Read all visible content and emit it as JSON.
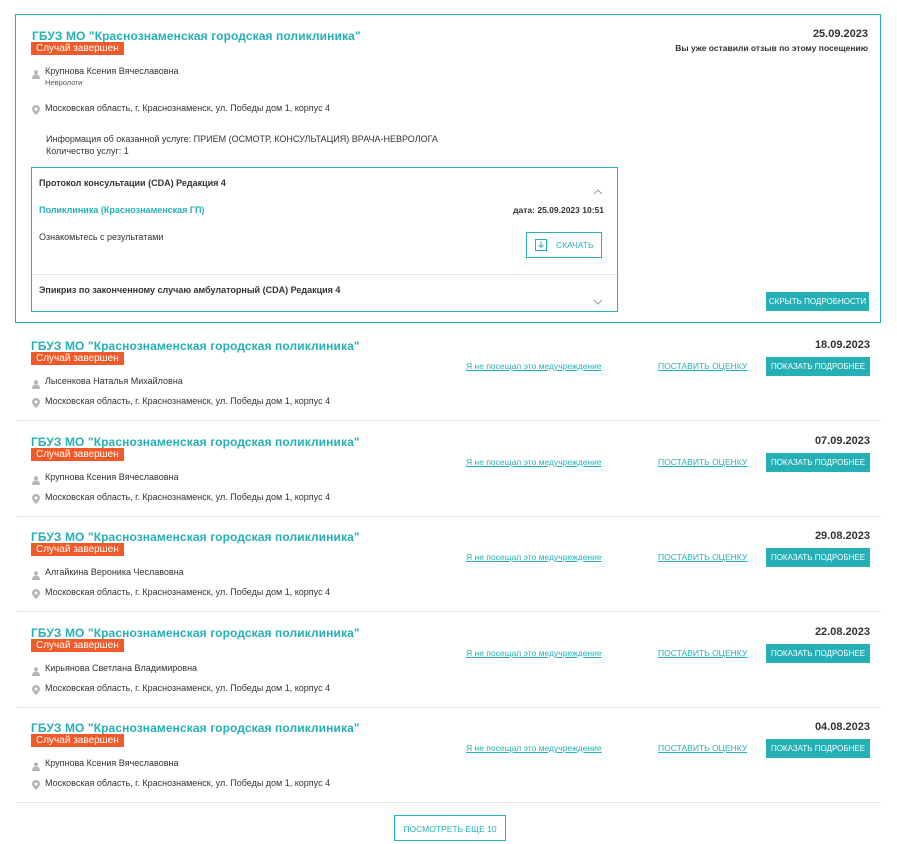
{
  "expanded": {
    "clinic": "ГБУЗ МО \"Краснознаменская городская поликлиника\"",
    "status": "Случай завершен",
    "doctor": "Крупнова Ксения Вячеславовна",
    "specialty": "Неврологи",
    "address": "Московская область, г. Краснознаменск, ул. Победы дом 1, корпус 4",
    "service_info": "Информация об оказанной услуге: ПРИЕМ (ОСМОТР, КОНСУЛЬТАЦИЯ) ВРАЧА-НЕВРОЛОГА",
    "service_count": "Количество услуг: 1",
    "date": "25.09.2023",
    "review_note": "Вы уже оставили отзыв по этому посещению",
    "protocol_title": "Протокол консультации (CDA) Редакция 4",
    "protocol_org": "Поликлиника (Краснознаменская ГП)",
    "protocol_date": "дата: 25.09.2023 10:51",
    "protocol_text": "Ознакомьтесь с результатами",
    "download_label": "СКАЧАТЬ",
    "epicrisis_title": "Эпикриз по законченному случаю амбулаторный (CDA) Редакция 4",
    "hide_label": "СКРЫТЬ ПОДРОБНОСТИ"
  },
  "visits": [
    {
      "clinic": "ГБУЗ МО \"Краснознаменская городская поликлиника\"",
      "status": "Случай завершен",
      "doctor": "Лысенкова Наталья Михайловна",
      "address": "Московская область, г. Краснознаменск, ул. Победы дом 1, корпус 4",
      "date": "18.09.2023",
      "not_visited": "Я не посещал это медучреждение",
      "rate": "ПОСТАВИТЬ ОЦЕНКУ",
      "details": "ПОКАЗАТЬ ПОДРОБНЕЕ"
    },
    {
      "clinic": "ГБУЗ МО \"Краснознаменская городская поликлиника\"",
      "status": "Случай завершен",
      "doctor": "Крупнова Ксения Вячеславовна",
      "address": "Московская область, г. Краснознаменск, ул. Победы дом 1, корпус 4",
      "date": "07.09.2023",
      "not_visited": "Я не посещал это медучреждение",
      "rate": "ПОСТАВИТЬ ОЦЕНКУ",
      "details": "ПОКАЗАТЬ ПОДРОБНЕЕ"
    },
    {
      "clinic": "ГБУЗ МО \"Краснознаменская городская поликлиника\"",
      "status": "Случай завершен",
      "doctor": "Алгайкина Вероника Чеславовна",
      "address": "Московская область, г. Краснознаменск, ул. Победы дом 1, корпус 4",
      "date": "29.08.2023",
      "not_visited": "Я не посещал это медучреждение",
      "rate": "ПОСТАВИТЬ ОЦЕНКУ",
      "details": "ПОКАЗАТЬ ПОДРОБНЕЕ"
    },
    {
      "clinic": "ГБУЗ МО \"Краснознаменская городская поликлиника\"",
      "status": "Случай завершен",
      "doctor": "Кирьянова Светлана Владимировна",
      "address": "Московская область, г. Краснознаменск, ул. Победы дом 1, корпус 4",
      "date": "22.08.2023",
      "not_visited": "Я не посещал это медучреждение",
      "rate": "ПОСТАВИТЬ ОЦЕНКУ",
      "details": "ПОКАЗАТЬ ПОДРОБНЕЕ"
    },
    {
      "clinic": "ГБУЗ МО \"Краснознаменская городская поликлиника\"",
      "status": "Случай завершен",
      "doctor": "Крупнова Ксения Вячеславовна",
      "address": "Московская область, г. Краснознаменск, ул. Победы дом 1, корпус 4",
      "date": "04.08.2023",
      "not_visited": "Я не посещал это медучреждение",
      "rate": "ПОСТАВИТЬ ОЦЕНКУ",
      "details": "ПОКАЗАТЬ ПОДРОБНЕЕ"
    }
  ],
  "more_label": "ПОСМОТРЕТЬ ЕЩЕ 10",
  "colors": {
    "accent": "#24b0b5",
    "badge": "#f05a28"
  }
}
